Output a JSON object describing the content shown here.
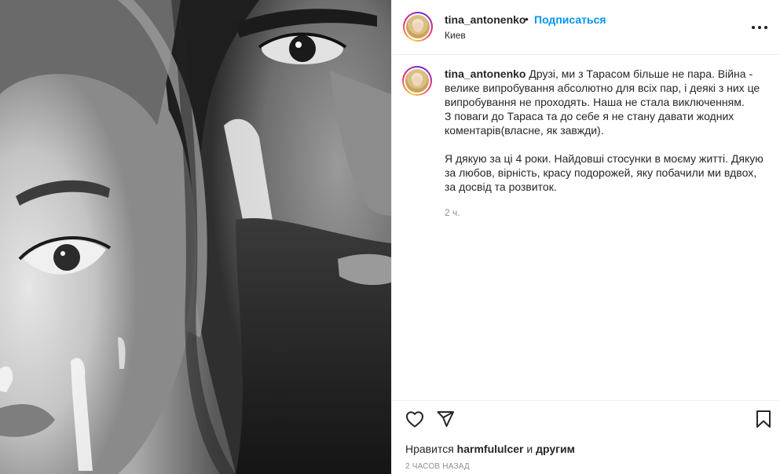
{
  "post": {
    "username": "tina_antonenko",
    "separator": "•",
    "follow_label": "Подписаться",
    "location": "Киев",
    "more_icon": "more-horizontal-icon"
  },
  "caption": {
    "username": "tina_antonenko",
    "text": "Друзі, ми з Тарасом більше не пара. Війна - велике випробування абсолютно для всіх пар, і деякі з них це випробування не проходять. Наша не стала виключенням.\nЗ поваги до Тараса та до себе я не стану давати жодних коментарів(власне, як завжди).\n\nЯ дякую за ці 4 роки. Найдовші стосунки в моєму житті. Дякую за любов, вірність, красу подорожей, яку побачили ми вдвох, за досвід та розвиток.",
    "time": "2 ч."
  },
  "actions": {
    "like_icon": "heart-icon",
    "comment_icon": "comment-icon",
    "share_icon": "send-icon",
    "save_icon": "bookmark-icon"
  },
  "likes": {
    "prefix": "Нравится",
    "user": "harmfululcer",
    "middle": "и",
    "suffix": "другим"
  },
  "timestamp": "2 ЧАСОВ НАЗАД",
  "colors": {
    "link": "#0095f6",
    "text": "#262626",
    "secondary": "#8e8e8e",
    "border": "#efefef"
  }
}
